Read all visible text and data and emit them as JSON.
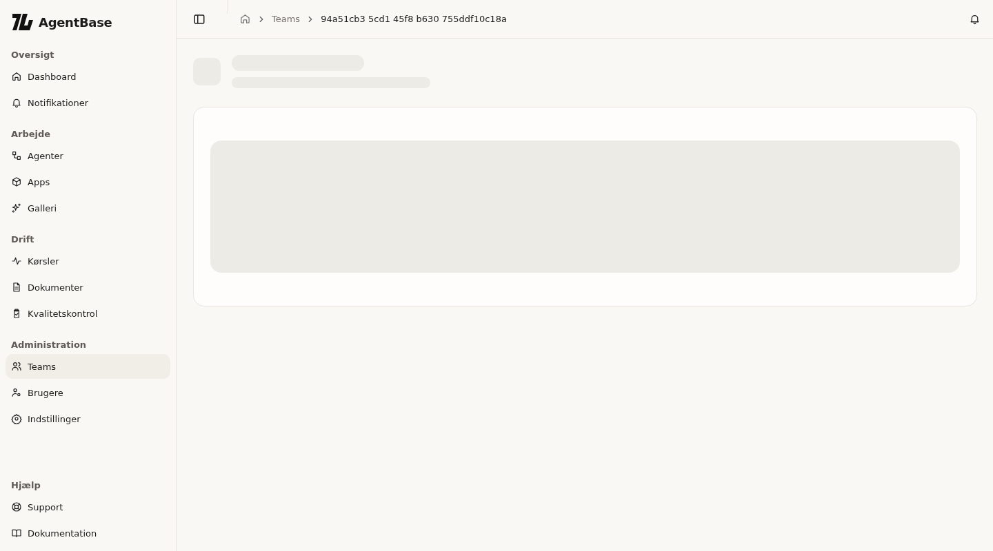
{
  "brand": {
    "name": "AgentBase"
  },
  "sidebar": {
    "sections": [
      {
        "title": "Oversigt",
        "items": [
          {
            "label": "Dashboard",
            "selected": false
          },
          {
            "label": "Notifikationer",
            "selected": false
          }
        ]
      },
      {
        "title": "Arbejde",
        "items": [
          {
            "label": "Agenter",
            "selected": false
          },
          {
            "label": "Apps",
            "selected": false
          },
          {
            "label": "Galleri",
            "selected": false
          }
        ]
      },
      {
        "title": "Drift",
        "items": [
          {
            "label": "Kørsler",
            "selected": false
          },
          {
            "label": "Dokumenter",
            "selected": false
          },
          {
            "label": "Kvalitetskontrol",
            "selected": false
          }
        ]
      },
      {
        "title": "Administration",
        "items": [
          {
            "label": "Teams",
            "selected": true
          },
          {
            "label": "Brugere",
            "selected": false
          },
          {
            "label": "Indstillinger",
            "selected": false
          }
        ]
      },
      {
        "title": "Hjælp",
        "items": [
          {
            "label": "Support",
            "selected": false
          },
          {
            "label": "Dokumentation",
            "selected": false
          }
        ]
      }
    ]
  },
  "breadcrumb": [
    "Teams",
    "94a51cb3 5cd1 45f8 b630 755ddf10c18a"
  ]
}
